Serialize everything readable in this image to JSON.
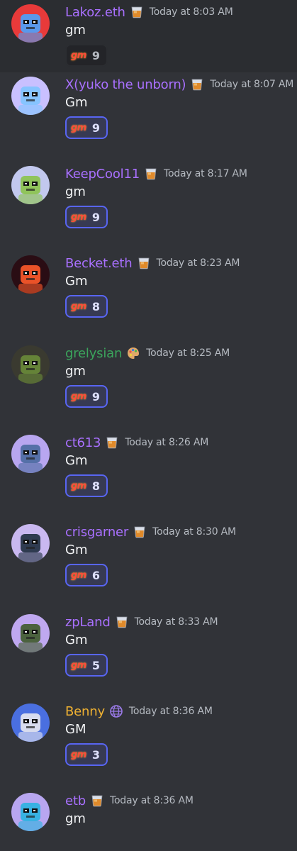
{
  "channel": {
    "messages": [
      {
        "username": "Lakoz.eth",
        "username_color": "#a970ff",
        "role_icon": "whiskey-glass-icon",
        "timestamp": "Today at 8:03 AM",
        "text": "gm",
        "reaction": {
          "emoji": "gm",
          "count": "9",
          "selected": false
        },
        "avatar": {
          "name": "lakoz-avatar",
          "bg": "#e83a3a",
          "fg": "#4aa3ff"
        }
      },
      {
        "username": "X(yuko the unborn)",
        "username_color": "#a970ff",
        "role_icon": "whiskey-glass-icon",
        "timestamp": "Today at 8:07 AM",
        "text": "Gm",
        "reaction": {
          "emoji": "gm",
          "count": "9",
          "selected": true
        },
        "avatar": {
          "name": "yuko-avatar",
          "bg": "#c9c0ff",
          "fg": "#7fc4ff"
        }
      },
      {
        "username": "KeepCool11",
        "username_color": "#a970ff",
        "role_icon": "whiskey-glass-icon",
        "timestamp": "Today at 8:17 AM",
        "text": "gm",
        "reaction": {
          "emoji": "gm",
          "count": "9",
          "selected": true
        },
        "avatar": {
          "name": "keepcool-avatar",
          "bg": "#c2c8ee",
          "fg": "#8bc34a"
        }
      },
      {
        "username": "Becket.eth",
        "username_color": "#a970ff",
        "role_icon": "whiskey-glass-icon",
        "timestamp": "Today at 8:23 AM",
        "text": "Gm",
        "reaction": {
          "emoji": "gm",
          "count": "8",
          "selected": true
        },
        "avatar": {
          "name": "becket-avatar",
          "bg": "#2a0d14",
          "fg": "#ff5a2a"
        }
      },
      {
        "username": "grelysian",
        "username_color": "#3ba55c",
        "role_icon": "artist-palette-icon",
        "timestamp": "Today at 8:25 AM",
        "text": "gm",
        "reaction": {
          "emoji": "gm",
          "count": "9",
          "selected": true
        },
        "avatar": {
          "name": "grelysian-avatar",
          "bg": "#3a3a30",
          "fg": "#6a8c3a"
        }
      },
      {
        "username": "ct613",
        "username_color": "#a970ff",
        "role_icon": "whiskey-glass-icon",
        "timestamp": "Today at 8:26 AM",
        "text": "Gm",
        "reaction": {
          "emoji": "gm",
          "count": "8",
          "selected": true
        },
        "avatar": {
          "name": "ct613-avatar",
          "bg": "#b8a6f0",
          "fg": "#4a6aa0"
        }
      },
      {
        "username": "crisgarner",
        "username_color": "#a970ff",
        "role_icon": "whiskey-glass-icon",
        "timestamp": "Today at 8:30 AM",
        "text": "Gm",
        "reaction": {
          "emoji": "gm",
          "count": "6",
          "selected": true
        },
        "avatar": {
          "name": "crisgarner-avatar",
          "bg": "#c9b8f0",
          "fg": "#1e2e3e"
        }
      },
      {
        "username": "zpLand",
        "username_color": "#a970ff",
        "role_icon": "whiskey-glass-icon",
        "timestamp": "Today at 8:33 AM",
        "text": "Gm",
        "reaction": {
          "emoji": "gm",
          "count": "5",
          "selected": true
        },
        "avatar": {
          "name": "zpland-avatar",
          "bg": "#bfa8f0",
          "fg": "#3e5a2a"
        }
      },
      {
        "username": "Benny",
        "username_color": "#f0b232",
        "role_icon": "globe-icon",
        "timestamp": "Today at 8:36 AM",
        "text": "GM",
        "reaction": {
          "emoji": "gm",
          "count": "3",
          "selected": true
        },
        "avatar": {
          "name": "benny-avatar",
          "bg": "#4a6fe0",
          "fg": "#e8e8f0"
        }
      },
      {
        "username": "etb",
        "username_color": "#a970ff",
        "role_icon": "whiskey-glass-icon",
        "timestamp": "Today at 8:36 AM",
        "text": "gm",
        "reaction": null,
        "avatar": {
          "name": "etb-avatar",
          "bg": "#b8a6f0",
          "fg": "#2ab4e0"
        }
      }
    ]
  }
}
